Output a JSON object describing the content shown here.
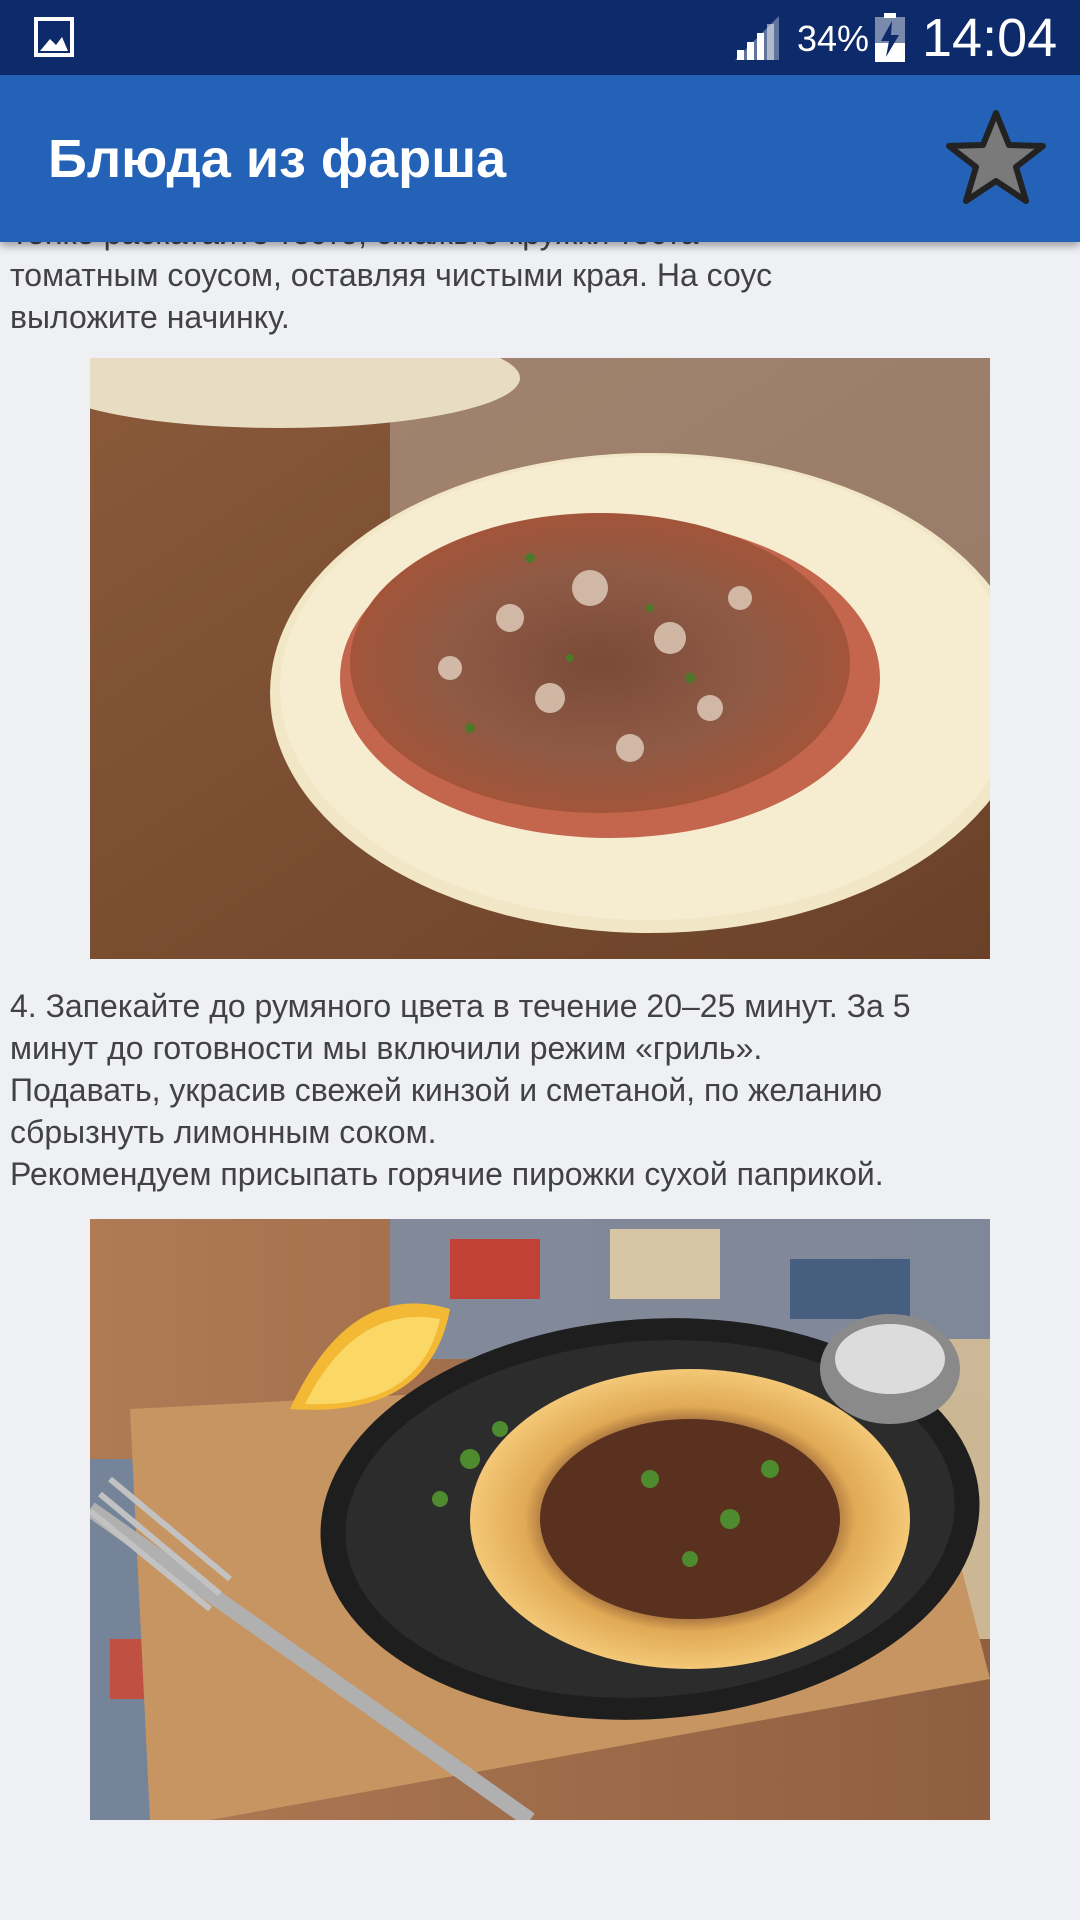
{
  "status_bar": {
    "notification_icon": "image-icon",
    "signal_icon": "signal-icon",
    "battery_percent": "34%",
    "battery_icon": "battery-charging-icon",
    "time": "14:04",
    "background_color": "#0d2a6b"
  },
  "app_bar": {
    "title": "Блюда из фарша",
    "favorite_icon": "star-icon",
    "background_color": "#2462b8"
  },
  "content": {
    "paragraph_top": "Тонко раскатайте тесто, смажьте кружки теста\nтоматным соусом, оставляя чистыми края. На соус\nвыложите начинку.",
    "image_1": "photo-raw-pie-with-meat-filling",
    "paragraph_step4": "4. Запекайте до румяного цвета в течение 20–25 минут. За 5\nминут до готовности мы включили режим «гриль».\n Подавать, украсив свежей кинзой и сметаной, по желанию\nсбрызнуть лимонным соком.\nРекомендуем присыпать горячие пирожки сухой паприкой.",
    "image_2": "photo-baked-pie-on-iron-plate-with-lemon"
  }
}
